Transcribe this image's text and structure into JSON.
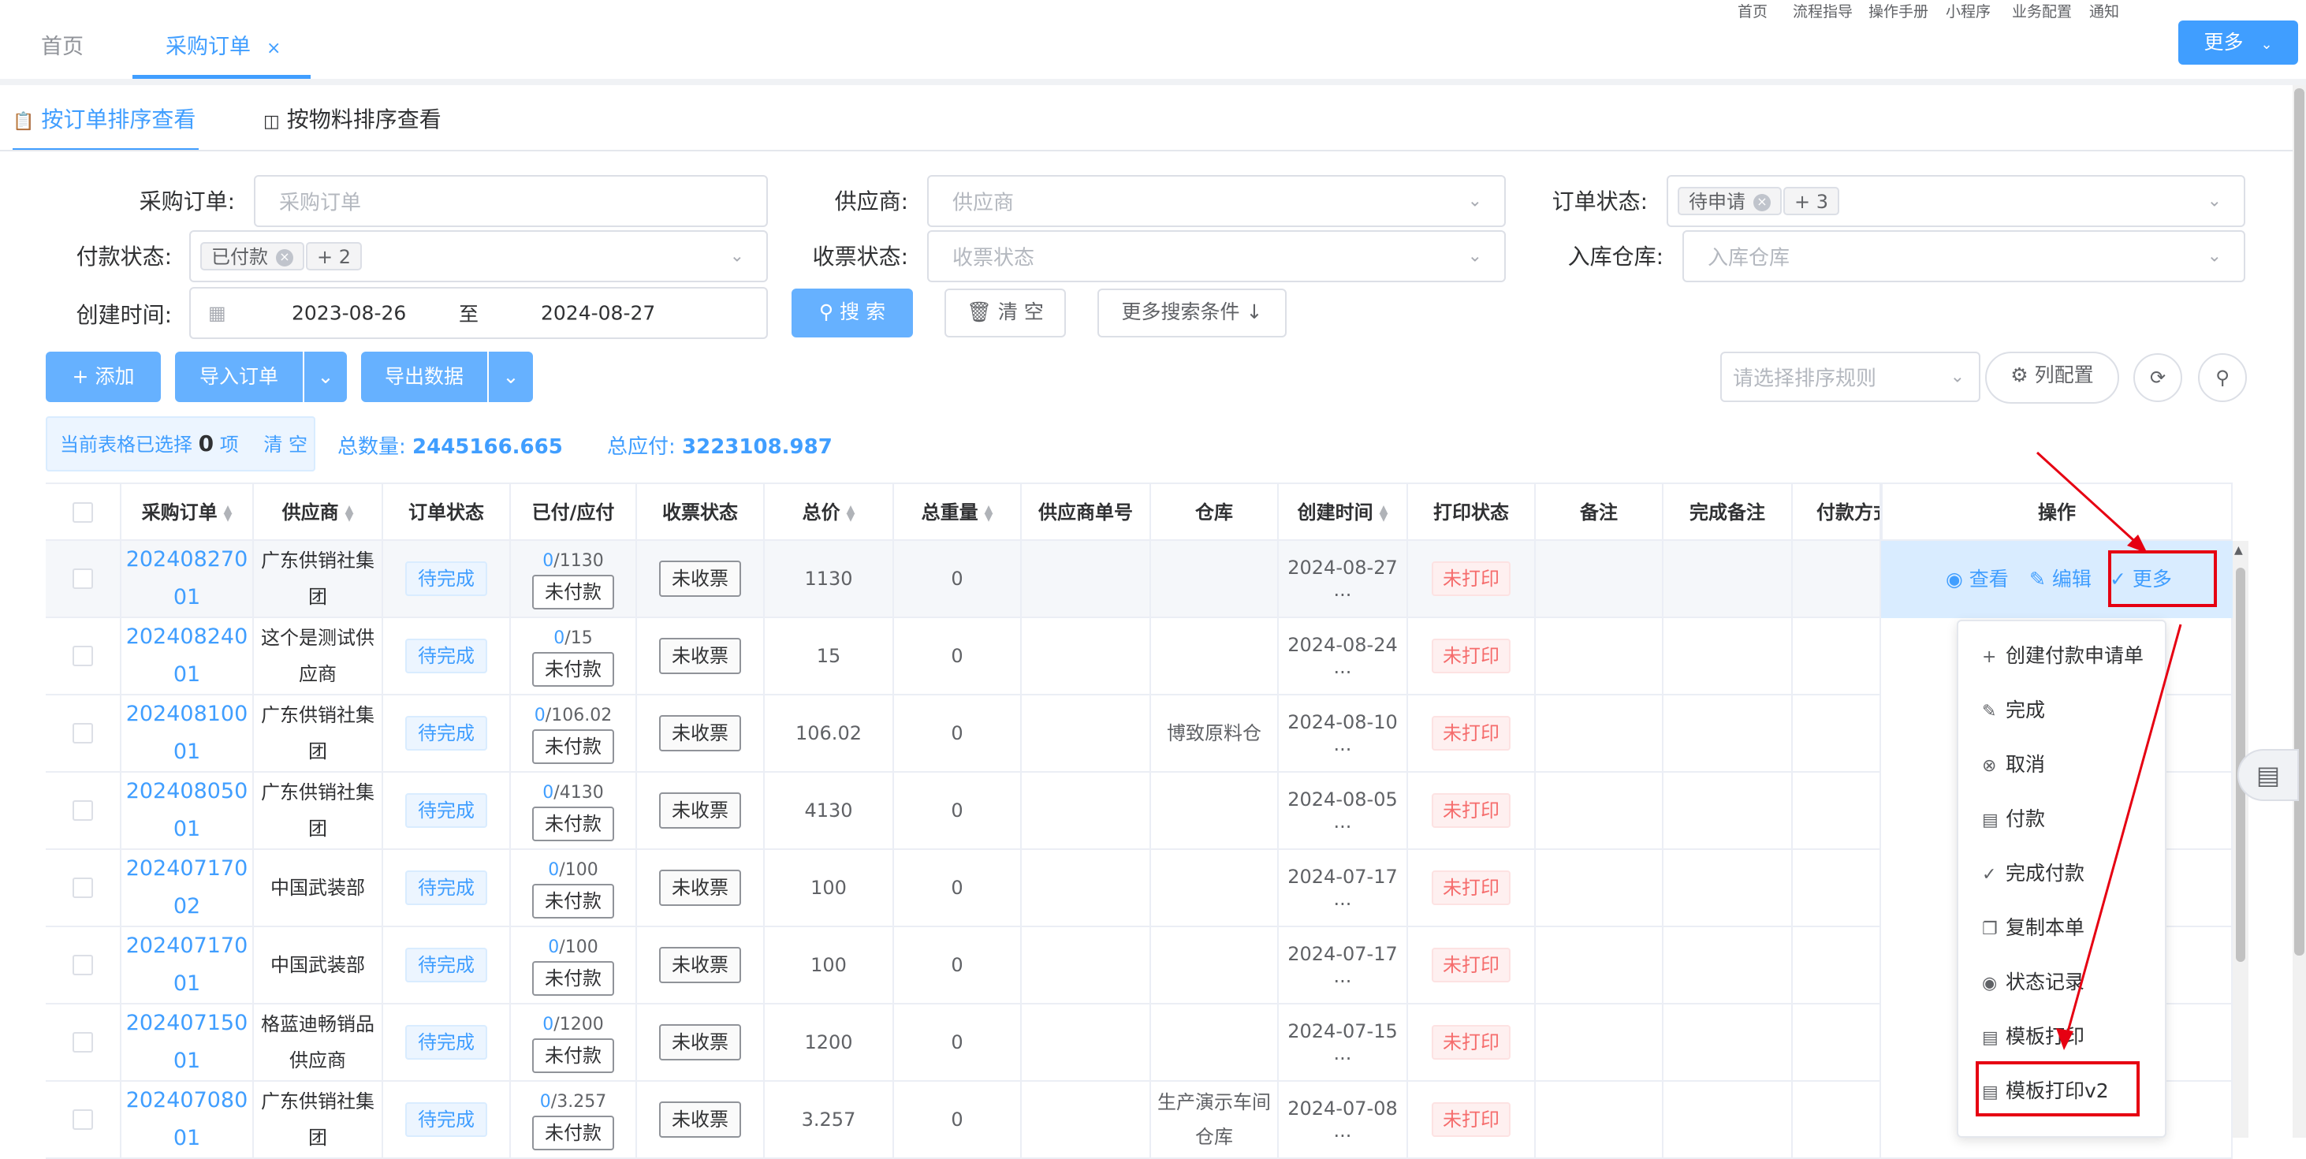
{
  "header": {
    "top_links": [
      "首页",
      "流程指导",
      "操作手册",
      "小程序",
      "业务配置",
      "通知"
    ],
    "tabs": [
      {
        "label": "首页"
      },
      {
        "label": "采购订单"
      }
    ],
    "close_glyph": "×",
    "more_button": "更多"
  },
  "view_tabs": [
    {
      "label": "按订单排序查看",
      "icon": "clipboard-icon"
    },
    {
      "label": "按物料排序查看",
      "icon": "box-icon"
    }
  ],
  "filters": {
    "po_label": "采购订单:",
    "po_placeholder": "采购订单",
    "supplier_label": "供应商:",
    "supplier_placeholder": "供应商",
    "order_status_label": "订单状态:",
    "order_status_tag": "待申请",
    "order_status_more": "+ 3",
    "pay_status_label": "付款状态:",
    "pay_status_tag": "已付款",
    "pay_status_more": "+ 2",
    "invoice_status_label": "收票状态:",
    "invoice_status_placeholder": "收票状态",
    "warehouse_label": "入库仓库:",
    "warehouse_placeholder": "入库仓库",
    "created_label": "创建时间:",
    "date_from": "2023-08-26",
    "date_sep": "至",
    "date_to": "2024-08-27",
    "search_button": "搜 索",
    "clear_button": "清 空",
    "more_conditions_button": "更多搜索条件 ↓"
  },
  "toolbar": {
    "add_button": "添加",
    "import_button": "导入订单",
    "export_button": "导出数据",
    "sort_placeholder": "请选择排序规则",
    "column_config_button": "列配置"
  },
  "summary": {
    "selection_prefix": "当前表格已选择",
    "selection_count": "0",
    "selection_suffix": "项",
    "clear_link": "清 空",
    "total_qty_label": "总数量:",
    "total_qty": "2445166.665",
    "total_payable_label": "总应付:",
    "total_payable": "3223108.987"
  },
  "table": {
    "columns": [
      "采购订单",
      "供应商",
      "订单状态",
      "已付/应付",
      "收票状态",
      "总价",
      "总重量",
      "供应商单号",
      "仓库",
      "创建时间",
      "打印状态",
      "备注",
      "完成备注",
      "付款方式",
      "操作"
    ],
    "rows": [
      {
        "po": "20240827001",
        "supplier": "广东供销社集团",
        "status": "待完成",
        "paid": "0",
        "payable": "/1130",
        "pay_state": "未付款",
        "invoice": "未收票",
        "total": "1130",
        "weight": "0",
        "warehouse": "",
        "created": "2024-08-27 ...",
        "print": "未打印"
      },
      {
        "po": "20240824001",
        "supplier": "这个是测试供应商",
        "status": "待完成",
        "paid": "0",
        "payable": "/15",
        "pay_state": "未付款",
        "invoice": "未收票",
        "total": "15",
        "weight": "0",
        "warehouse": "",
        "created": "2024-08-24 ...",
        "print": "未打印"
      },
      {
        "po": "20240810001",
        "supplier": "广东供销社集团",
        "status": "待完成",
        "paid": "0",
        "payable": "/106.02",
        "pay_state": "未付款",
        "invoice": "未收票",
        "total": "106.02",
        "weight": "0",
        "warehouse": "博致原料仓",
        "created": "2024-08-10 ...",
        "print": "未打印"
      },
      {
        "po": "20240805001",
        "supplier": "广东供销社集团",
        "status": "待完成",
        "paid": "0",
        "payable": "/4130",
        "pay_state": "未付款",
        "invoice": "未收票",
        "total": "4130",
        "weight": "0",
        "warehouse": "",
        "created": "2024-08-05 ...",
        "print": "未打印"
      },
      {
        "po": "20240717002",
        "supplier": "中国武装部",
        "status": "待完成",
        "paid": "0",
        "payable": "/100",
        "pay_state": "未付款",
        "invoice": "未收票",
        "total": "100",
        "weight": "0",
        "warehouse": "",
        "created": "2024-07-17 ...",
        "print": "未打印"
      },
      {
        "po": "20240717001",
        "supplier": "中国武装部",
        "status": "待完成",
        "paid": "0",
        "payable": "/100",
        "pay_state": "未付款",
        "invoice": "未收票",
        "total": "100",
        "weight": "0",
        "warehouse": "",
        "created": "2024-07-17 ...",
        "print": "未打印"
      },
      {
        "po": "20240715001",
        "supplier": "格蓝迪畅销品供应商",
        "status": "待完成",
        "paid": "0",
        "payable": "/1200",
        "pay_state": "未付款",
        "invoice": "未收票",
        "total": "1200",
        "weight": "0",
        "warehouse": "",
        "created": "2024-07-15 ...",
        "print": "未打印"
      },
      {
        "po": "20240708001",
        "supplier": "广东供销社集团",
        "status": "待完成",
        "paid": "0",
        "payable": "/3.257",
        "pay_state": "未付款",
        "invoice": "未收票",
        "total": "3.257",
        "weight": "0",
        "warehouse": "生产演示车间仓库",
        "created": "2024-07-08 ...",
        "print": "未打印"
      }
    ],
    "ops": {
      "view": "查看",
      "edit": "编辑",
      "more": "更多"
    }
  },
  "dropdown": [
    {
      "label": "创建付款申请单",
      "icon": "plus-icon"
    },
    {
      "label": "完成",
      "icon": "edit-icon"
    },
    {
      "label": "取消",
      "icon": "cancel-circle-icon"
    },
    {
      "label": "付款",
      "icon": "card-icon"
    },
    {
      "label": "完成付款",
      "icon": "check-pay-icon"
    },
    {
      "label": "复制本单",
      "icon": "copy-icon"
    },
    {
      "label": "状态记录",
      "icon": "eye-icon"
    },
    {
      "label": "模板打印",
      "icon": "print-icon"
    },
    {
      "label": "模板打印v2",
      "icon": "print-icon"
    }
  ],
  "colors": {
    "primary": "#409eff",
    "danger": "#f56c6c",
    "highlight": "#e60012"
  }
}
